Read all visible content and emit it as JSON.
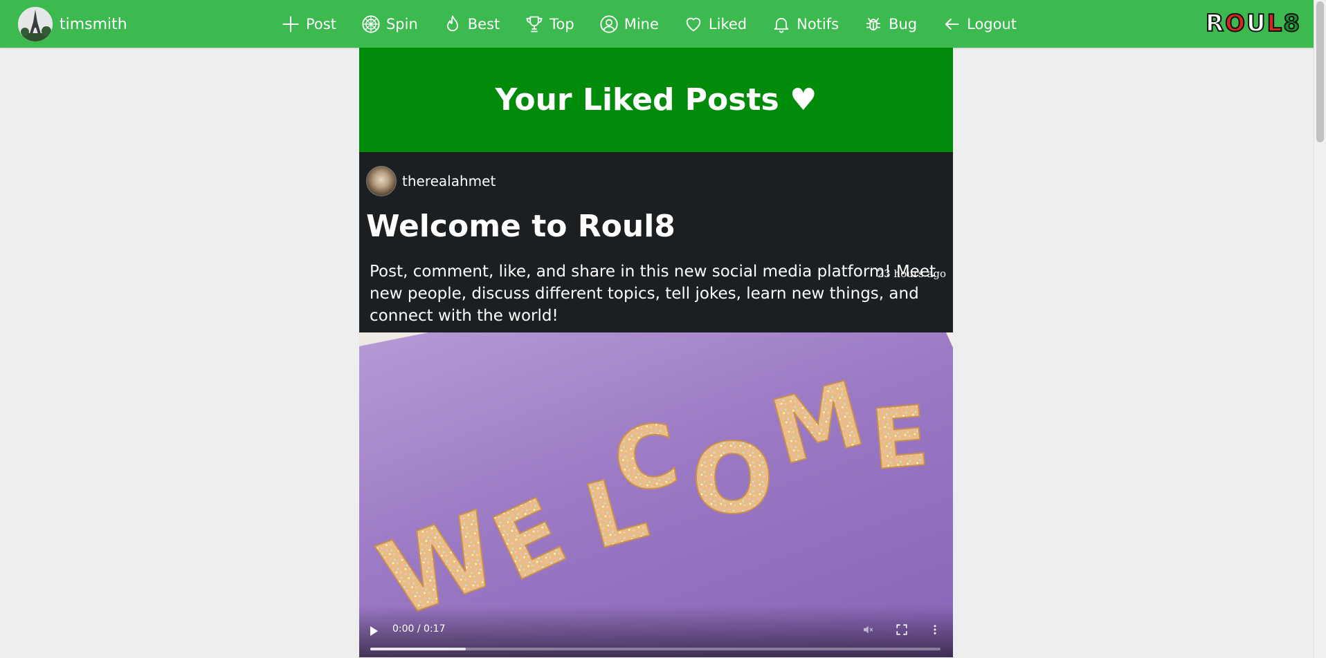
{
  "user": {
    "name": "timsmith"
  },
  "nav": [
    {
      "label": "Post",
      "icon": "plus-icon"
    },
    {
      "label": "Spin",
      "icon": "roulette-icon"
    },
    {
      "label": "Best",
      "icon": "flame-icon"
    },
    {
      "label": "Top",
      "icon": "trophy-icon"
    },
    {
      "label": "Mine",
      "icon": "user-circle-icon"
    },
    {
      "label": "Liked",
      "icon": "heart-icon"
    },
    {
      "label": "Notifs",
      "icon": "bell-icon"
    },
    {
      "label": "Bug",
      "icon": "bug-icon"
    },
    {
      "label": "Logout",
      "icon": "arrow-left-icon"
    }
  ],
  "logo": {
    "letters": [
      "R",
      "O",
      "U",
      "L",
      "8"
    ]
  },
  "banner": {
    "title": "Your Liked Posts ♥"
  },
  "post": {
    "author": "therealahmet",
    "time": "23 hours ago",
    "title": "Welcome to Roul8",
    "body": "Post, comment, like, and share in this new social media platform! Meet new people, discuss different topics, tell jokes, learn new things, and connect with the world!",
    "media": {
      "letters": [
        "W",
        "E",
        "L",
        "C",
        "O",
        "M",
        "E"
      ],
      "time_display": "0:00 / 0:17",
      "progress": 0.0
    }
  },
  "colors": {
    "nav_bg": "#3cba4f",
    "banner_bg": "#008b0b",
    "post_bg": "#1b1f22",
    "page_bg": "#eeeeee"
  }
}
